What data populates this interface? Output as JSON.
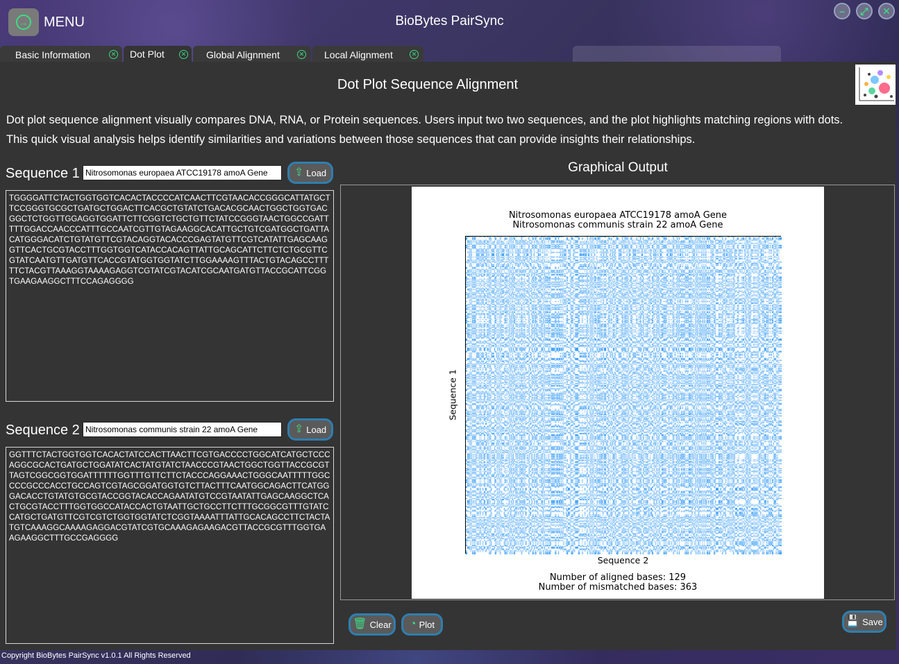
{
  "app": {
    "menu_label": "MENU",
    "title": "BioBytes PairSync",
    "icons": [
      "arrow-right-icon",
      "minimize-icon",
      "maximize-icon",
      "close-icon"
    ]
  },
  "tabs": [
    {
      "label": "Basic Information",
      "active": false
    },
    {
      "label": "Dot Plot",
      "active": true
    },
    {
      "label": "Global Alignment",
      "active": false
    },
    {
      "label": "Local Alignment",
      "active": false
    }
  ],
  "page": {
    "title": "Dot Plot Sequence Alignment",
    "description_line1": "Dot plot sequence alignment visually compares DNA, RNA, or Protein sequences. Users input two two sequences, and the plot highlights matching regions with dots.",
    "description_line2": "This quick visual analysis helps identify similarities and variations between those sequences that can provide insights their relationships."
  },
  "seq1": {
    "label": "Sequence 1",
    "name": "Nitrosomonas europaea ATCC19178 amoA Gene",
    "load_label": "Load",
    "sequence": "TGGGGATTCTACTGGTGGTCACACTACCCCATCAACTTCGTAACACCGGGCATTATGCTTCCGGGTGCGCTGATGCTGGACTTCACGCTGTATCTGACACGCAACTGGCTGGTGACGGCTCTGGTTGGAGGTGGATTCTTCGGTCTGCTGTTCTATCCGGGTAACTGGCCGATTTTTGGACCAACCCATTTGCCAATCGTTGTAGAAGGCACATTGCTGTCGATGGCTGATTACATGGGACATCTGTATGTTCGTACAGGTACACCCGAGTATGTTCGTCATATTGAGCAAGGTTCACTGCGTACCTTTGGTGGTCATACCACAGTTATTGCAGCATTCTTCTCTGCGTTCGTATCAATGTTGATGTTCACCGTATGGTGGTATCTTGGAAAAGTTTACTGTACAGCCTTTTTCTACGTTAAAGGTAAAAGAGGTCGTATCGTACATCGCAATGATGTTACCGCATTCGGTGAAGAAGGCTTTCCAGAGGGG"
  },
  "seq2": {
    "label": "Sequence 2",
    "name": "Nitrosomonas communis strain 22 amoA Gene",
    "load_label": "Load",
    "sequence": "GGTTTCTACTGGTGGTCACACTATCCACTTAACTTCGTGACCCCTGGCATCATGCTCCCAGGCGCACTGATGCTGGATATCACTATGTATCTAACCCGTAACTGGCTGGTTACCGCGTTAGTCGGCGGTGGATTTTTTGGTTTGTTCTTCTACCCAGGAAACTGGGCAATTTTTGGCCCCGCCCACCTGCCAGTCGTAGCGGATGGTGTCTTACTTTCAATGGCAGACTTCATGGGACACCTGTATGTGCGTACCGGTACACCAGAATATGTCCGTAATATTGAGCAAGGCTCACTGCGTACCTTTGGTGGCCATACCACTGTAATTGCTGCCTTCTTTGCGGCGTTTGTATCCATGCTGATGTTCGTCGTCTGGTGGTATCTCGGTAAAATTTATTGCACAGCCTTCTACTATGTCAAAGGCAAAAGAGGACGTATCGTGCAAAGAGAAGACGTTACCGCGTTTGGTGAAGAAGGCTTTGCCGAGGGG"
  },
  "output": {
    "section_title": "Graphical Output",
    "clear_label": "Clear",
    "plot_label": "Plot",
    "save_label": "Save"
  },
  "chart_data": {
    "type": "heatmap",
    "title_line1": "Nitrosomonas europaea ATCC19178 amoA Gene",
    "title_line2": "Nitrosomonas communis strain 22 amoA Gene",
    "xlabel": "Sequence 2",
    "ylabel": "Sequence 1",
    "dot_color": "#1e90ff",
    "aligned_label": "Number of aligned bases: 129",
    "mismatched_label": "Number of mismatched bases: 363"
  },
  "footer": {
    "copyright": "Copyright BioBytes PairSync v1.0.1 All Rights Reserved"
  }
}
